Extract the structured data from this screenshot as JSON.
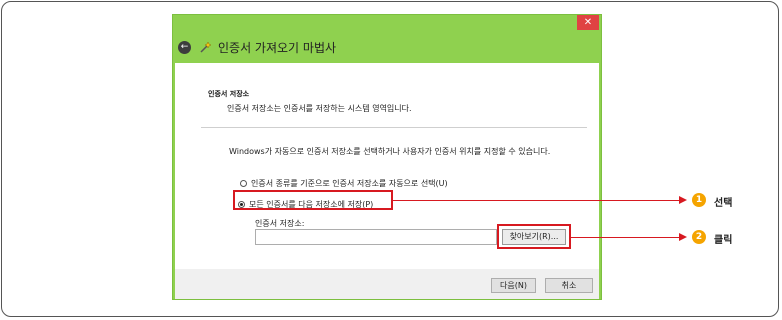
{
  "window": {
    "title": "인증서 가져오기 마법사",
    "close_label": "✕"
  },
  "section": {
    "title": "인증서 저장소",
    "description": "인증서 저장소는 인증서를 저장하는 시스템 영역입니다."
  },
  "instruction": "Windows가 자동으로 인증서 저장소를 선택하거나 사용자가 인증서 위치를 지정할 수 있습니다.",
  "options": [
    {
      "label": "인증서 종류를 기준으로 인증서 저장소를 자동으로 선택(U)",
      "checked": false
    },
    {
      "label": "모든 인증서를 다음 저장소에 저장(P)",
      "checked": true
    }
  ],
  "store": {
    "label": "인증서 저장소:",
    "value": "",
    "browse_label": "찾아보기(R)..."
  },
  "footer": {
    "next_label": "다음(N)",
    "cancel_label": "취소"
  },
  "callouts": [
    {
      "number": "1",
      "text": "선택"
    },
    {
      "number": "2",
      "text": "클릭"
    }
  ],
  "colors": {
    "window_frame": "#8fd14f",
    "highlight": "#d71920",
    "callout_badge": "#f5a400"
  },
  "icons": {
    "back": "back-arrow-icon",
    "wizard": "certificate-wizard-icon",
    "close": "close-icon"
  }
}
